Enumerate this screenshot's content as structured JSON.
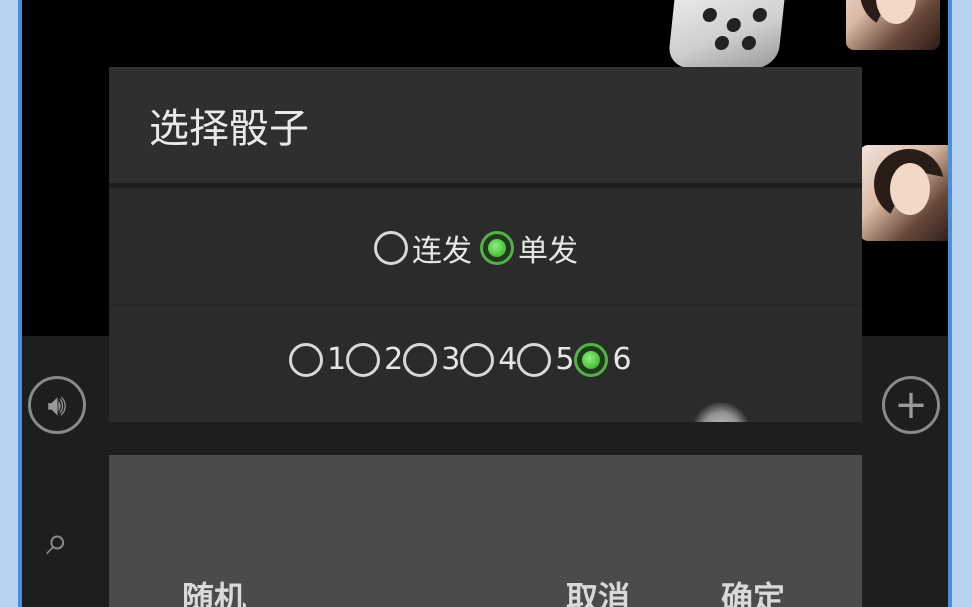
{
  "dialog": {
    "title": "选择骰子",
    "fire_mode": {
      "options": [
        {
          "label": "连发",
          "selected": false
        },
        {
          "label": "单发",
          "selected": true
        }
      ]
    },
    "dice_value": {
      "options": [
        {
          "label": "1",
          "selected": false
        },
        {
          "label": "2",
          "selected": false
        },
        {
          "label": "3",
          "selected": false
        },
        {
          "label": "4",
          "selected": false
        },
        {
          "label": "5",
          "selected": false
        },
        {
          "label": "6",
          "selected": true
        }
      ]
    },
    "buttons": {
      "random": "随机",
      "cancel": "取消",
      "confirm": "确定"
    }
  },
  "icons": {
    "voice": "voice-icon",
    "plus": "plus-icon",
    "search": "search-icon",
    "dice": "dice-icon"
  },
  "colors": {
    "accent_green": "#3fbf2f",
    "dialog_bg": "#2b2b2b",
    "button_bar_bg": "#4b4b4b"
  }
}
